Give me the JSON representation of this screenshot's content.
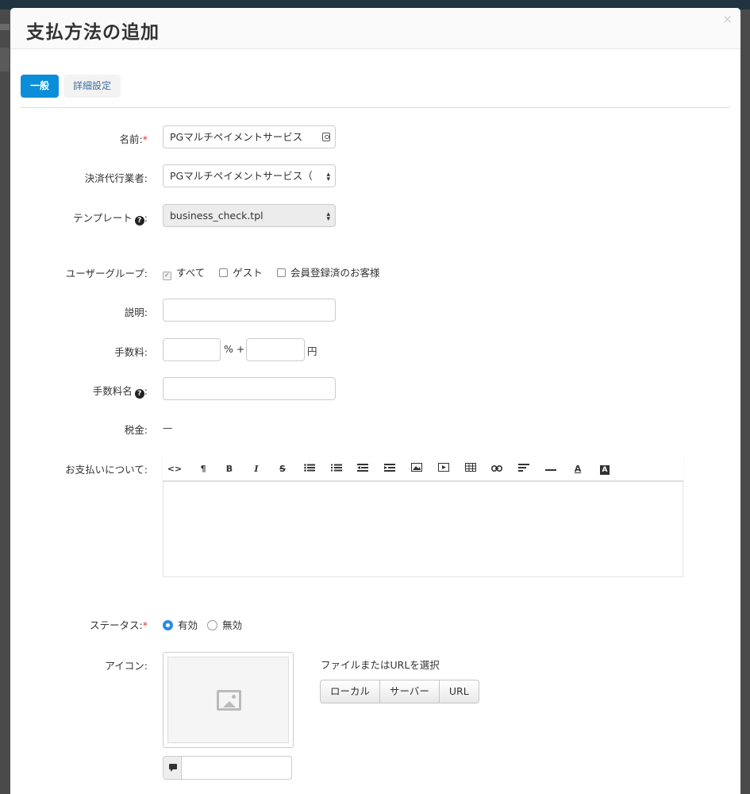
{
  "modal": {
    "title": "支払方法の追加",
    "close": "×"
  },
  "tabs": [
    {
      "label": "一般",
      "active": true
    },
    {
      "label": "詳細設定",
      "active": false
    }
  ],
  "fields": {
    "name": {
      "label": "名前:",
      "required": "*",
      "value": "PGマルチペイメントサービス"
    },
    "processor": {
      "label": "決済代行業者:",
      "value": "PGマルチペイメントサービス（"
    },
    "template": {
      "label": "テンプレート",
      "colon": ":",
      "value": "business_check.tpl"
    },
    "usergroups": {
      "label": "ユーザーグループ:",
      "options": [
        {
          "label": "すべて",
          "checked": true
        },
        {
          "label": "ゲスト",
          "checked": false
        },
        {
          "label": "会員登録済のお客様",
          "checked": false
        }
      ]
    },
    "description": {
      "label": "説明:",
      "value": ""
    },
    "surcharge": {
      "label": "手数料:",
      "percent_value": "",
      "percent_sign": "% +",
      "fixed_value": "",
      "currency": "円"
    },
    "surcharge_name": {
      "label": "手数料名",
      "colon": ":",
      "value": ""
    },
    "tax": {
      "label": "税金:",
      "value": "—"
    },
    "instructions": {
      "label": "お支払いについて:"
    },
    "status": {
      "label": "ステータス:",
      "required": "*",
      "options": [
        {
          "label": "有効",
          "selected": true
        },
        {
          "label": "無効",
          "selected": false
        }
      ]
    },
    "icon": {
      "label": "アイコン:",
      "file_label": "ファイルまたはURLを選択",
      "buttons": [
        "ローカル",
        "サーバー",
        "URL"
      ],
      "alt_value": ""
    }
  },
  "toolbar": [
    "<>",
    "¶",
    "B",
    "I",
    "S",
    "ul",
    "ol",
    "outdent",
    "indent",
    "image",
    "video",
    "table",
    "link",
    "align",
    "hr",
    "A",
    "A"
  ],
  "help_glyph": "?"
}
